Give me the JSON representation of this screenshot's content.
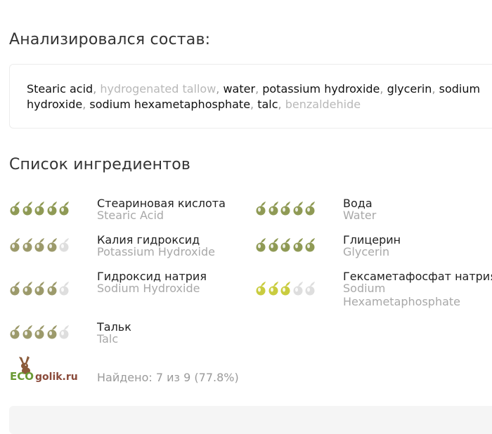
{
  "composition": {
    "title": "Анализировался состав:",
    "items": [
      {
        "text": "Stearic acid",
        "known": true
      },
      {
        "text": "hydrogenated tallow",
        "known": false
      },
      {
        "text": "water",
        "known": true
      },
      {
        "text": "potassium hydroxide",
        "known": true
      },
      {
        "text": "glycerin",
        "known": true
      },
      {
        "text": "sodium hydroxide",
        "known": true
      },
      {
        "text": "sodium hexametaphosphate",
        "known": true
      },
      {
        "text": "talc",
        "known": true
      },
      {
        "text": "benzaldehide",
        "known": false
      }
    ]
  },
  "ingredients": {
    "title": "Список ингредиентов",
    "items": [
      {
        "name_ru": "Стеариновая кислота",
        "name_en": "Stearic Acid",
        "rating": 5,
        "color": "#8f9a55"
      },
      {
        "name_ru": "Вода",
        "name_en": "Water",
        "rating": 5,
        "color": "#8f9a55"
      },
      {
        "name_ru": "Калия гидроксид",
        "name_en": "Potassium Hydroxide",
        "rating": 4,
        "color": "#9c9a6b"
      },
      {
        "name_ru": "Глицерин",
        "name_en": "Glycerin",
        "rating": 5,
        "color": "#8f9a55"
      },
      {
        "name_ru": "Гидроксид натрия",
        "name_en": "Sodium Hydroxide",
        "rating": 4,
        "color": "#9c9a6b"
      },
      {
        "name_ru": "Гексаметафосфат натрия",
        "name_en": "Sodium Hexametaphosphate",
        "rating": 3,
        "color": "#c9cc3f"
      },
      {
        "name_ru": "Тальк",
        "name_en": "Talc",
        "rating": 4,
        "color": "#9c9a6b"
      }
    ],
    "empty_color": "#dedede"
  },
  "footer": {
    "logo_text": "ECOgolik.ru",
    "found_text": "Найдено: 7 из 9 (77.8%)"
  },
  "icons": {
    "rating_icon": "olive-icon",
    "logo_icon": "rabbit-icon"
  }
}
